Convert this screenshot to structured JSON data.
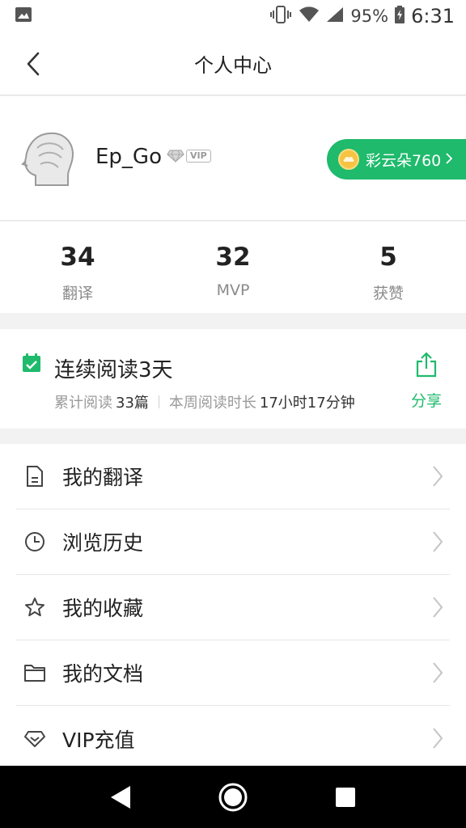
{
  "status_bar": {
    "battery": "95%",
    "time": "6:31"
  },
  "header": {
    "title": "个人中心"
  },
  "profile": {
    "username": "Ep_Go",
    "vip_tag": "VIP",
    "coins_label": "彩云朵760"
  },
  "stats": [
    {
      "value": "34",
      "label": "翻译"
    },
    {
      "value": "32",
      "label": "MVP"
    },
    {
      "value": "5",
      "label": "获赞"
    }
  ],
  "reading": {
    "title": "连续阅读3天",
    "total_label": "累计阅读",
    "total_value": "33篇",
    "week_label": "本周阅读时长",
    "week_value": "17小时17分钟",
    "share_label": "分享"
  },
  "menu": [
    {
      "label": "我的翻译",
      "icon": "document-icon"
    },
    {
      "label": "浏览历史",
      "icon": "clock-icon"
    },
    {
      "label": "我的收藏",
      "icon": "star-icon"
    },
    {
      "label": "我的文档",
      "icon": "folder-icon"
    },
    {
      "label": "VIP充值",
      "icon": "diamond-icon"
    }
  ],
  "colors": {
    "accent": "#1fba6c",
    "coin": "#f6c343"
  }
}
